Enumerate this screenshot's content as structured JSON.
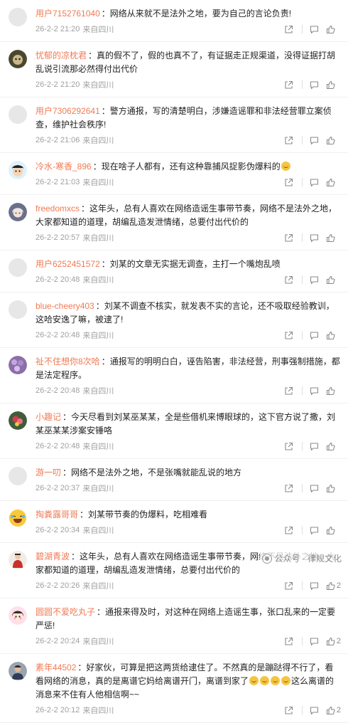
{
  "colors": {
    "username": "#f07a53",
    "text": "#222222",
    "meta": "#a0a0a0",
    "background": "#ffffff"
  },
  "icons": [
    "share-icon",
    "comment-reply-icon",
    "like-icon"
  ],
  "comments": [
    {
      "user": "用户7152761040",
      "text": "网络从来就不是法外之地，要为自己的言论负责!",
      "time": "26-2-2 21:20",
      "location": "来自四川",
      "likes": "",
      "avatar": "empty"
    },
    {
      "user": "忧郁的凉枕君",
      "text": "真的假不了，假的也真不了，有证据走正规渠道，没得证据打胡乱说引流那必然得付出代价",
      "time": "26-2-2 21:20",
      "location": "来自四川",
      "likes": "",
      "avatar": "dark-cat"
    },
    {
      "user": "用户7306292641",
      "text": "警方通报，写的清楚明白，涉嫌造谣罪和非法经营罪立案侦查，维护社会秩序!",
      "time": "26-2-2 21:06",
      "location": "来自四川",
      "likes": "",
      "avatar": "empty"
    },
    {
      "user": "冷水-寒香_896",
      "text": "现在啥子人都有，还有这种靠捕风捉影伪爆料的",
      "emoji_after": true,
      "time": "26-2-2 21:03",
      "location": "来自四川",
      "likes": "",
      "avatar": "cartoon-boy"
    },
    {
      "user": "freedomxcs",
      "text": "这年头，总有人喜欢在网络造谣生事带节奏，网络不是法外之地，大家都知道的道理，胡编乱造发泄情绪，总要付出代价的",
      "time": "26-2-2 20:57",
      "location": "来自四川",
      "likes": "",
      "avatar": "anime-girl"
    },
    {
      "user": "用户6252451572",
      "text": "刘某的文章无实据无调查，主打一个嘴炮乱喷",
      "time": "26-2-2 20:48",
      "location": "来自四川",
      "likes": "",
      "avatar": "empty"
    },
    {
      "user": "blue-cheery403",
      "text": "刘某不调查不核实，就发表不实的言论，还不吸取经验教训，这哈安逸了嘛，被逮了!",
      "time": "26-2-2 20:48",
      "location": "来自四川",
      "likes": "",
      "avatar": "empty"
    },
    {
      "user": "祉不住想你8次哈",
      "text": "通报写的明明白白，诬告陷害，非法经营，刑事强制措施，都是法定程序。",
      "time": "26-2-2 20:48",
      "location": "来自四川",
      "likes": "",
      "avatar": "purple-flowers"
    },
    {
      "user": "小趣记",
      "text": "今天尽看到刘某巫某某，全是些借机来博眼球的，这下官方说了撒，刘某巫某某涉案安锤咯",
      "time": "26-2-2 20:48",
      "location": "来自四川",
      "likes": "",
      "avatar": "red-flower"
    },
    {
      "user": "游一叨",
      "text": "网络不是法外之地，不是张嘴就能乱说的地方",
      "time": "26-2-2 20:37",
      "location": "来自四川",
      "likes": "",
      "avatar": "empty"
    },
    {
      "user": "掏粪露哥哥",
      "text": "刘某带节奏的伪爆料，吃相难看",
      "time": "26-2-2 20:34",
      "location": "来自四川",
      "likes": "",
      "avatar": "laugh-emoji"
    },
    {
      "user": "碧湖青波",
      "text": "这年头，总有人喜欢在网络造谣生事带节奏，网络不是法外之地，大家都知道的道理，胡编乱造发泄情绪，总要付出代价的",
      "time": "26-2-2 20:26",
      "location": "来自四川",
      "likes": "2",
      "avatar": "figure-red"
    },
    {
      "user": "圆圆不爱吃丸子",
      "text": "通报来得及时，对这种在网络上造谣生事，张口乱来的一定要严惩!",
      "time": "26-2-2 20:24",
      "location": "来自四川",
      "likes": "2",
      "avatar": "cartoon-girl"
    },
    {
      "user": "素年44502",
      "text": "好家伙，可算是把这两货给逮住了。不然真的是蹦跶得不行了，看看网络的消息，真的是离谱它妈给离谱开门，离谱到家了",
      "emoji_count": 4,
      "text2": "这么离谱的消息来不住有人他相信啊~~",
      "time": "26-2-2 20:12",
      "location": "来自四川",
      "likes": "2",
      "avatar": "man-photo"
    }
  ],
  "watermark": "公众号 · 律规文化"
}
